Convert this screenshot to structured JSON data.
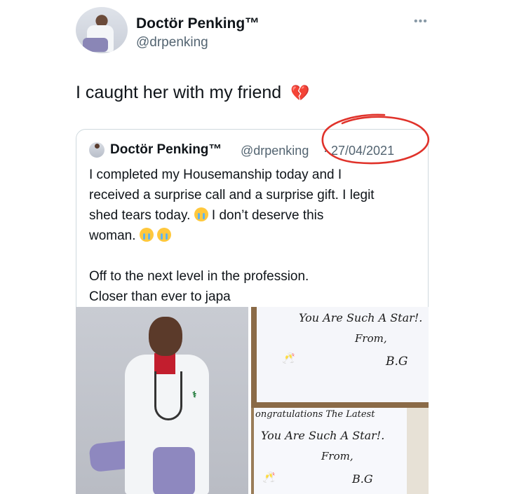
{
  "author": {
    "name": "Doctör Penking™",
    "handle": "@drpenking",
    "more_icon": "more-icon"
  },
  "tweet": {
    "text": "I caught her with my friend",
    "emoji": "💔"
  },
  "quoted": {
    "name": "Doctör Penking™",
    "handle": "@drpenking",
    "date": "· 27/04/2021",
    "lines": [
      "I completed my Housemanship today and I",
      "received a surprise call and a surprise gift. I legit",
      "shed tears today.",
      "I don’t deserve this",
      "woman.",
      "Off to the next level in the profession.",
      "Closer than ever to japa"
    ]
  },
  "card_top": {
    "line1": "You Are Such A Star!.",
    "line2": "From,",
    "line3": "B.G"
  },
  "card_bottom": {
    "line0": "ongratulations The Latest",
    "line1": "You Are Such A Star!.",
    "line2": "From,",
    "line3": "B.G"
  },
  "colors": {
    "handle_gray": "#536471",
    "annotation_red": "#e0322a"
  }
}
